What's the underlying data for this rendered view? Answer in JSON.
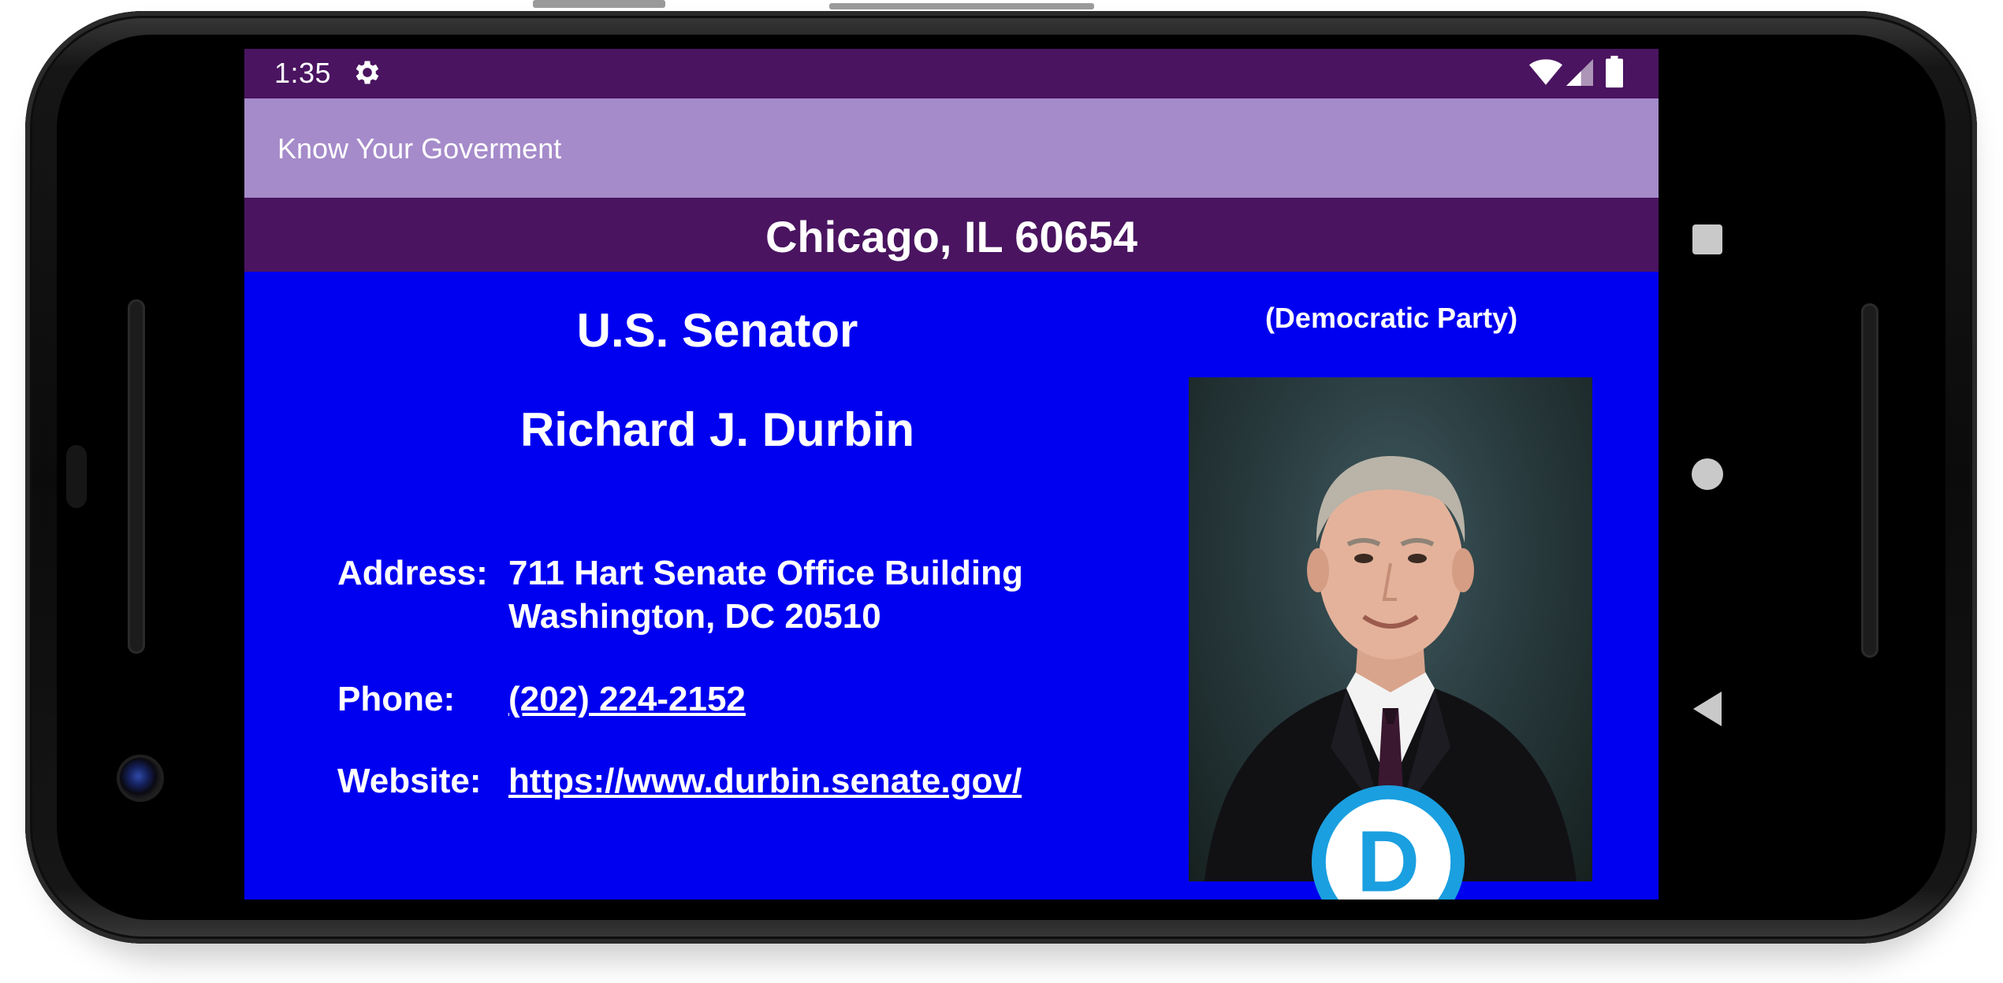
{
  "status_bar": {
    "time": "1:35",
    "icons": [
      "gear-icon",
      "wifi-icon",
      "cell-signal-icon",
      "battery-icon"
    ]
  },
  "app_bar": {
    "title": "Know Your Goverment"
  },
  "location": {
    "text": "Chicago, IL 60654"
  },
  "official": {
    "office": "U.S. Senator",
    "name": "Richard J. Durbin",
    "party": "(Democratic Party)",
    "address_label": "Address:",
    "address_line1": "711 Hart Senate Office Building",
    "address_line2": "Washington, DC 20510",
    "phone_label": "Phone:",
    "phone": "(202) 224-2152",
    "website_label": "Website:",
    "website": "https://www.durbin.senate.gov/",
    "party_logo_letter": "D"
  },
  "nav": {
    "icons": [
      "recents-square-icon",
      "home-circle-icon",
      "back-triangle-icon"
    ]
  },
  "colors": {
    "status_bar": "#4a1460",
    "app_bar": "#a58bca",
    "content_bg": "#0000f0",
    "party_logo": "#1a9fe0",
    "text": "#ffffff"
  }
}
